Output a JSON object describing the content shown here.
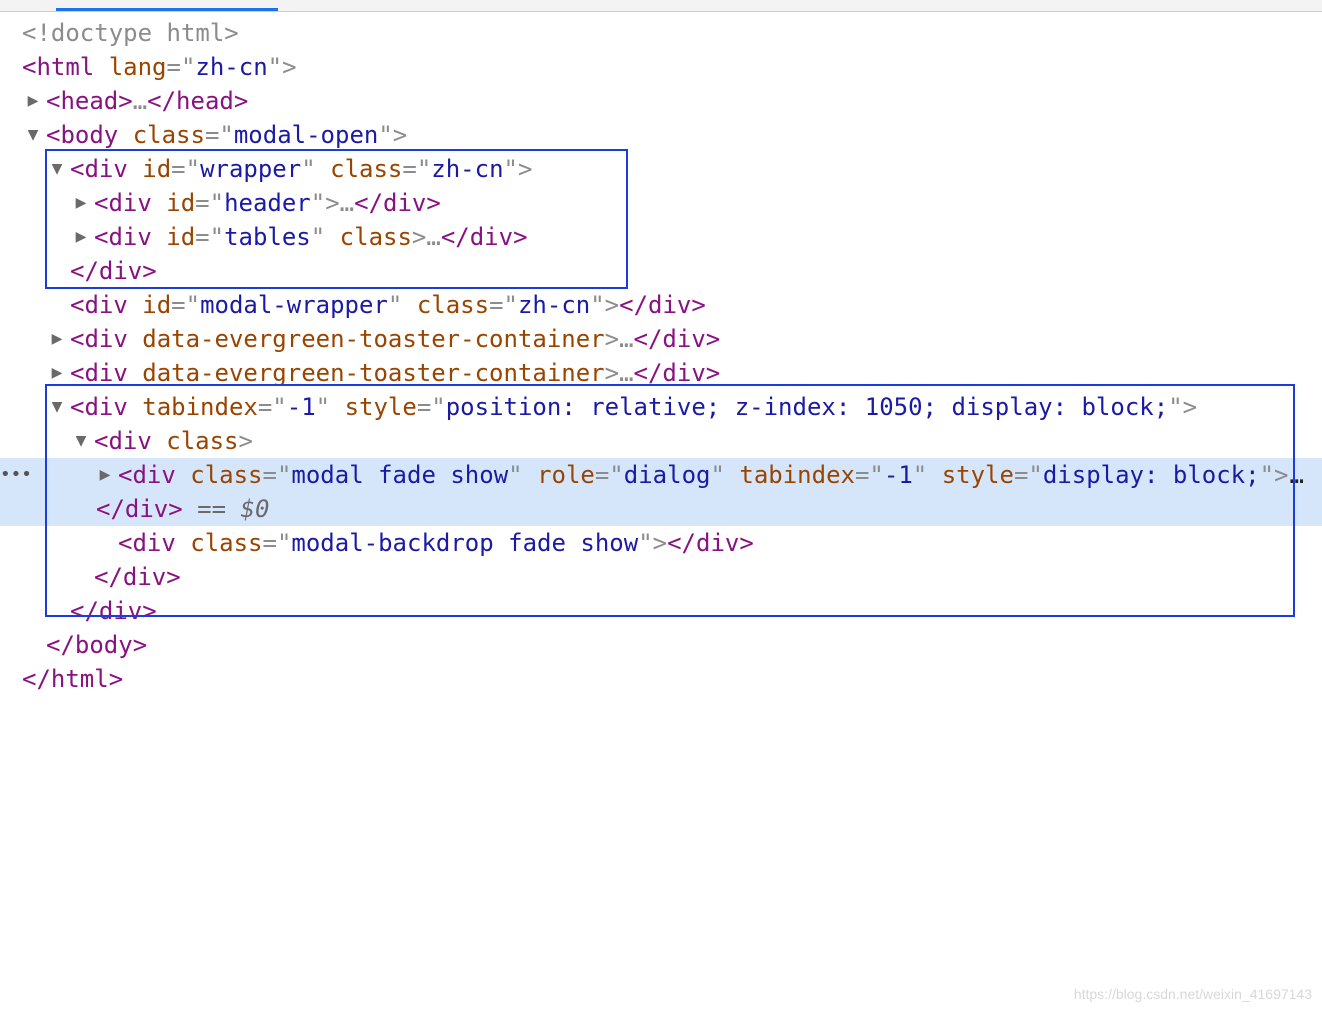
{
  "ellipsis": "…",
  "rows": [
    {
      "id": "doctype",
      "text": "<!doctype html>"
    },
    {
      "id": "html-open",
      "tag_open": "<html",
      "attr1": "lang",
      "eq1": "=\"",
      "val1": "zh-cn",
      "close1": "\">"
    },
    {
      "id": "head",
      "tag_open": "<head>",
      "ellipsis": "…",
      "tag_close": "</head>"
    },
    {
      "id": "body-open",
      "tag_open": "<body",
      "attr1": "class",
      "eq1": "=\"",
      "val1": "modal-open",
      "close1": "\">"
    },
    {
      "id": "wrapper-open",
      "tag_open": "<div",
      "attr1": "id",
      "eq1": "=\"",
      "val1": "wrapper",
      "q1": "\"",
      "attr2": "class",
      "eq2": "=\"",
      "val2": "zh-cn",
      "close1": "\">"
    },
    {
      "id": "header",
      "tag_open": "<div",
      "attr1": "id",
      "eq1": "=\"",
      "val1": "header",
      "close1": "\">",
      "ellipsis": "…",
      "tag_close": "</div>"
    },
    {
      "id": "tables",
      "tag_open": "<div",
      "attr1": "id",
      "eq1": "=\"",
      "val1": "tables",
      "q1": "\"",
      "attr2": "class",
      "close1": ">",
      "ellipsis": "…",
      "tag_close": "</div>"
    },
    {
      "id": "wrapper-close",
      "tag_close": "</div>"
    },
    {
      "id": "modal-wrapper",
      "tag_open": "<div",
      "attr1": "id",
      "eq1": "=\"",
      "val1": "modal-wrapper",
      "q1": "\"",
      "attr2": "class",
      "eq2": "=\"",
      "val2": "zh-cn",
      "close1": "\">",
      "tag_close": "</div>"
    },
    {
      "id": "toaster-1",
      "tag_open": "<div",
      "attr1": "data-evergreen-toaster-container",
      "close1": ">",
      "ellipsis": "…",
      "tag_close": "</div>"
    },
    {
      "id": "toaster-2",
      "tag_open": "<div",
      "attr1": "data-evergreen-toaster-container",
      "close1": ">",
      "ellipsis": "…",
      "tag_close": "</div>"
    },
    {
      "id": "tabindex-open",
      "tag_open": "<div",
      "attr1": "tabindex",
      "eq1": "=\"",
      "val1": "-1",
      "q1": "\"",
      "attr2": "style",
      "eq2": "=\"",
      "val2": "position: relative; z-index: 1050; display: block;",
      "close1": "\">"
    },
    {
      "id": "div-class-open",
      "tag_open": "<div",
      "attr1": "class",
      "close1": ">"
    },
    {
      "id": "modal-dialog",
      "tag_open": "<div",
      "attr1": "class",
      "eq1": "=\"",
      "val1": "modal fade show",
      "q1": "\"",
      "attr2": "role",
      "eq2": "=\"",
      "val2": "dialog",
      "q2": "\"",
      "attr3": "tabindex",
      "eq3": "=\"",
      "val3": "-1",
      "q3": "\"",
      "attr4": "style",
      "eq4": "=\"",
      "val4": "display: block;",
      "close1": "\">",
      "ellipsis": "…"
    },
    {
      "id": "modal-dialog-close",
      "tag_close": "</div>",
      "marker": "== $0"
    },
    {
      "id": "backdrop",
      "tag_open": "<div",
      "attr1": "class",
      "eq1": "=\"",
      "val1": "modal-backdrop fade show",
      "close1": "\">",
      "tag_close": "</div>"
    },
    {
      "id": "div-class-close",
      "tag_close": "</div>"
    },
    {
      "id": "tabindex-close",
      "tag_close": "</div>"
    },
    {
      "id": "body-close",
      "tag_close": "</body>"
    },
    {
      "id": "html-close",
      "tag_close": "</html>"
    }
  ],
  "gutter": "•••",
  "colors": {
    "tag": "#881280",
    "attribute": "#994500",
    "value": "#1a1aa6",
    "selection": "#d5e6fb",
    "highlight_box": "#1a3ddb"
  },
  "icons": {
    "collapsed": "triangle-right-icon",
    "expanded": "triangle-down-icon"
  },
  "watermark": "https://blog.csdn.net/weixin_41697143"
}
